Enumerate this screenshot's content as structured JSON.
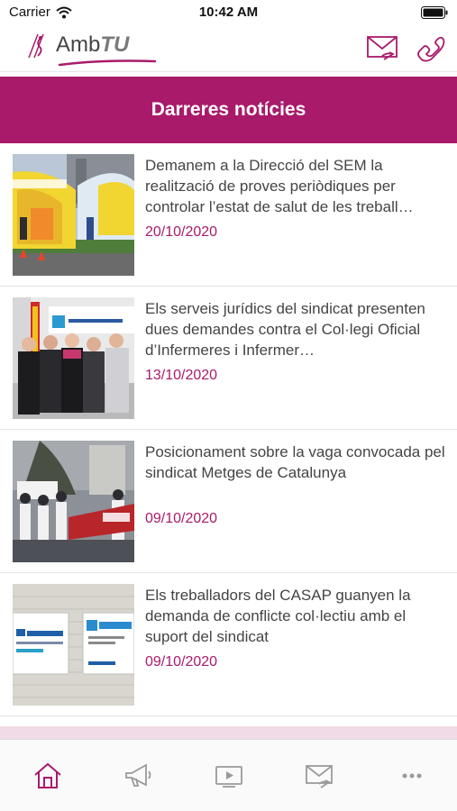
{
  "status_bar": {
    "carrier": "Carrier",
    "time": "10:42 AM"
  },
  "header": {
    "logo_text": "Amb",
    "logo_text_accent": "TU",
    "icons": [
      "mail-icon",
      "phone-icon"
    ]
  },
  "section": {
    "title": "Darreres notícies"
  },
  "news": [
    {
      "title": "Demanem a la Direcció del SEM la realització de proves periòdiques per controlar l’estat de salut de les treball…",
      "date": "20/10/2020"
    },
    {
      "title": "Els serveis jurídics del sindicat presenten dues demandes contra el Col·legi Oficial d’Infermeres i Infermer…",
      "date": "13/10/2020"
    },
    {
      "title": "Posicionament sobre la vaga convocada pel sindicat Metges de Catalunya",
      "date": "09/10/2020"
    },
    {
      "title": "Els treballadors del CASAP guanyen la demanda de conflicte col·lectiu amb el suport del sindicat",
      "date": "09/10/2020"
    }
  ],
  "tab_bar": {
    "tabs": [
      "home-icon",
      "megaphone-icon",
      "video-icon",
      "mail-icon",
      "more-icon"
    ],
    "active": "home-icon"
  },
  "colors": {
    "accent": "#a91a6b",
    "accent_light": "#f1dbe7"
  }
}
